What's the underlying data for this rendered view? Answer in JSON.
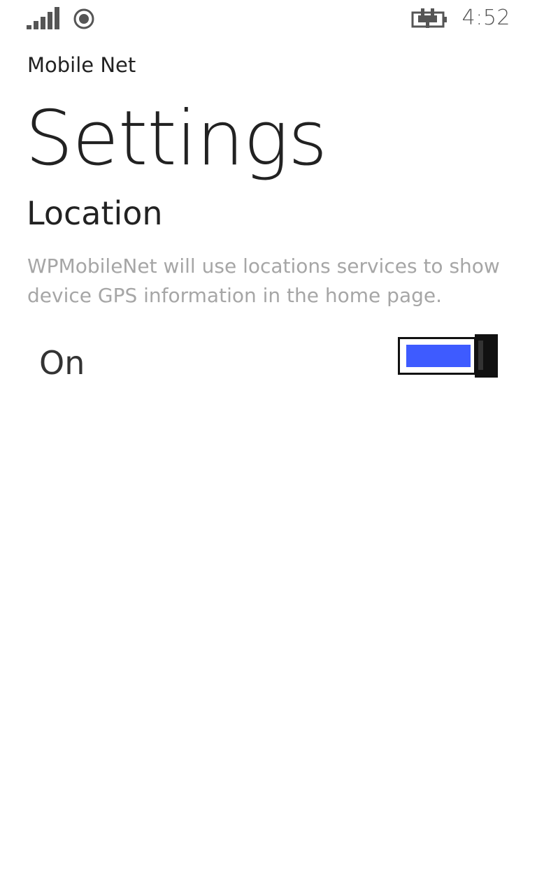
{
  "status_bar": {
    "time": "4:52",
    "icons": [
      "signal-bars-icon",
      "location-status-icon",
      "charging-plug-icon"
    ]
  },
  "header": {
    "app_title": "Mobile Net",
    "page_title": "Settings"
  },
  "location": {
    "section_title": "Location",
    "description": "WPMobileNet will use locations services to show device GPS information in the home page.",
    "toggle": {
      "label": "On",
      "state": "on",
      "accent_color": "#3e5bff"
    }
  }
}
